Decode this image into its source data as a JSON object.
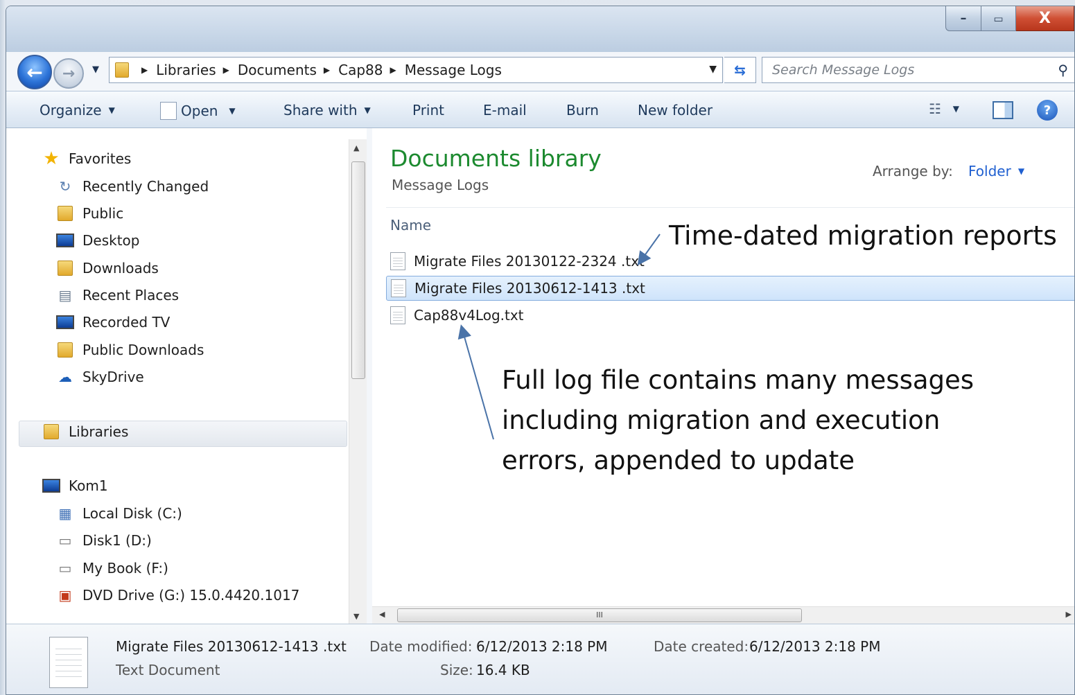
{
  "window": {
    "caption": {
      "minimize": "–",
      "maximize": "▭",
      "close": "X"
    }
  },
  "address": {
    "breadcrumbs": [
      "Libraries",
      "Documents",
      "Cap88",
      "Message Logs"
    ]
  },
  "search": {
    "placeholder": "Search Message Logs"
  },
  "toolbar": {
    "organize": "Organize",
    "open": "Open",
    "share_with": "Share with",
    "print": "Print",
    "email": "E-mail",
    "burn": "Burn",
    "new_folder": "New folder"
  },
  "navpane": {
    "favorites": {
      "label": "Favorites",
      "items": [
        "Recently Changed",
        "Public",
        "Desktop",
        "Downloads",
        "Recent Places",
        "Recorded TV",
        "Public Downloads",
        "SkyDrive"
      ]
    },
    "libraries": "Libraries",
    "computer": {
      "label": "Kom1",
      "items": [
        "Local Disk (C:)",
        "Disk1 (D:)",
        "My Book (F:)",
        "DVD Drive (G:) 15.0.4420.1017"
      ]
    }
  },
  "content": {
    "title": "Documents library",
    "subtitle": "Message Logs",
    "arrange_label": "Arrange by:",
    "arrange_value": "Folder",
    "column_name": "Name",
    "files": [
      {
        "name": "Migrate Files 20130122-2324 .txt",
        "selected": false
      },
      {
        "name": "Migrate Files 20130612-1413 .txt",
        "selected": true
      },
      {
        "name": "Cap88v4Log.txt",
        "selected": false
      }
    ],
    "scroll_grip": "III"
  },
  "annotations": {
    "time_dated": "Time-dated migration reports",
    "full_log": "Full log file contains many messages including migration and execution errors, appended to update"
  },
  "details": {
    "file_name": "Migrate Files 20130612-1413 .txt",
    "file_type": "Text Document",
    "modified_label": "Date modified:",
    "modified_value": "6/12/2013 2:18 PM",
    "created_label": "Date created:",
    "created_value": "6/12/2013 2:18 PM",
    "size_label": "Size:",
    "size_value": "16.4 KB"
  },
  "colors": {
    "title_green": "#1c8a2f",
    "link_blue": "#1f5fd0",
    "selection_border": "#84acdd"
  }
}
